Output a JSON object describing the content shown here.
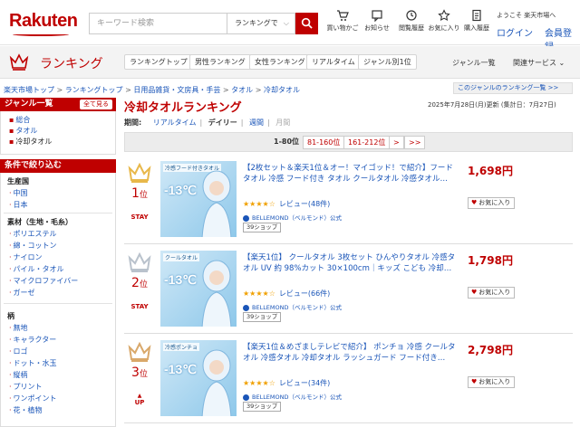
{
  "header": {
    "logo": "Rakuten",
    "search_placeholder": "キーワード検索",
    "search_scope": "ランキングで",
    "icons": [
      {
        "name": "cart-icon",
        "label": "買い物かご"
      },
      {
        "name": "notification-icon",
        "label": "お知らせ"
      },
      {
        "name": "history-icon",
        "label": "閲覧履歴"
      },
      {
        "name": "favorite-icon",
        "label": "お気に入り"
      },
      {
        "name": "purchase-history-icon",
        "label": "購入履歴"
      }
    ],
    "welcome": "ようこそ 楽天市場へ",
    "login": "ログイン",
    "member": "会員登録"
  },
  "rankbar": {
    "title": "ランキング",
    "nav": [
      "ランキングトップ",
      "男性ランキング",
      "女性ランキング",
      "リアルタイム",
      "ジャンル別1位"
    ],
    "genre_list": "ジャンル一覧",
    "related": "関連サービス"
  },
  "breadcrumb": [
    "楽天市場トップ",
    "ランキングトップ",
    "日用品雑貨・文房具・手芸",
    "タオル",
    "冷却タオル"
  ],
  "genre_ranking_link": "このジャンルのランキング一覧 >>",
  "sidebar": {
    "genre_head": "ジャンル一覧",
    "see_all": "全て見る",
    "genres": [
      "総合",
      "タオル",
      "冷却タオル"
    ],
    "filter_head": "条件で絞り込む",
    "groups": [
      {
        "title": "生産国",
        "items": [
          "中国",
          "日本"
        ]
      },
      {
        "title": "素材（生地・毛糸）",
        "items": [
          "ポリエステル",
          "綿・コットン",
          "ナイロン",
          "パイル・タオル",
          "マイクロファイバー",
          "ガーゼ"
        ]
      },
      {
        "title": "柄",
        "items": [
          "無地",
          "キャラクター",
          "ロゴ",
          "ドット・水玉",
          "縦柄",
          "プリント",
          "ワンポイント",
          "花・植物"
        ]
      }
    ]
  },
  "main": {
    "title": "冷却タオルランキング",
    "updated": "2025年7月28日(月)更新 (集計日：7月27日)",
    "period_label": "期間:",
    "periods": [
      "リアルタイム",
      "デイリー",
      "週間",
      "月間"
    ],
    "pager": [
      "1-80位",
      "81-160位",
      "161-212位",
      ">",
      ">>"
    ]
  },
  "items": [
    {
      "rank": "1",
      "rank_suffix": "位",
      "trend": "STAY",
      "title": "【2枚セット＆楽天1位＆オー！マイゴッド！で紹介】フードタオル 冷感 フード付き タオル クールタオル 冷感タオル…",
      "stars": "★★★★☆",
      "reviews": "レビュー(48件)",
      "shop": "BELLEMOND（ベルモンド）公式",
      "shop_badge": "39ショップ",
      "price": "1,698円",
      "fav": "お気に入り",
      "thumb_tag": "冷感フード付きタオル",
      "thumb_temp": "-13℃",
      "medal_color": "#e8b84a"
    },
    {
      "rank": "2",
      "rank_suffix": "位",
      "trend": "STAY",
      "title": "【楽天1位】 クールタオル 3枚セット ひんやりタオル 冷感タオル UV 約 98%カット 30×100cm｜キッズ こども 冷却…",
      "stars": "★★★★☆",
      "reviews": "レビュー(66件)",
      "shop": "BELLEMOND（ベルモンド）公式",
      "shop_badge": "39ショップ",
      "price": "1,798円",
      "fav": "お気に入り",
      "thumb_tag": "クールタオル",
      "thumb_temp": "-13℃",
      "medal_color": "#b9c2cc"
    },
    {
      "rank": "3",
      "rank_suffix": "位",
      "trend": "UP",
      "title": "【楽天1位＆めざましテレビで紹介】 ポンチョ 冷感 クールタオル 冷感タオル 冷却タオル ラッシュガード フード付き…",
      "stars": "★★★★☆",
      "reviews": "レビュー(34件)",
      "shop": "BELLEMOND（ベルモンド）公式",
      "shop_badge": "39ショップ",
      "price": "2,798円",
      "fav": "お気に入り",
      "thumb_tag": "冷感ポンチョ",
      "thumb_temp": "-13℃",
      "medal_color": "#d9a86a"
    }
  ]
}
